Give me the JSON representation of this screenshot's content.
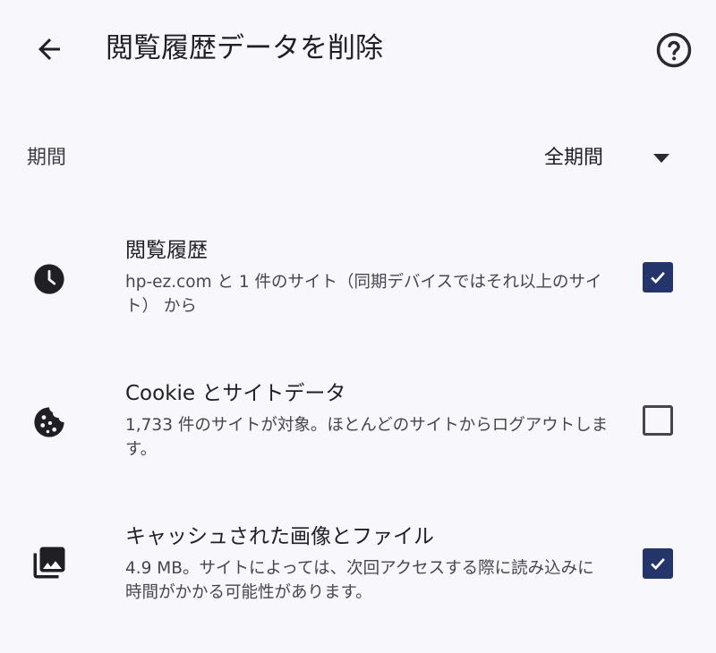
{
  "header": {
    "title": "閲覧履歴データを削除",
    "back_icon": "arrow-back-icon",
    "help_icon": "help-circle-icon"
  },
  "period": {
    "label": "期間",
    "value": "全期間"
  },
  "options": [
    {
      "icon": "clock-icon",
      "title": "閲覧履歴",
      "description": "hp-ez.com と 1 件のサイト（同期デバイスではそれ以上のサイト） から",
      "checked": true
    },
    {
      "icon": "cookie-icon",
      "title": "Cookie とサイトデータ",
      "description": "1,733 件のサイトが対象。ほとんどのサイトからログアウトします。",
      "checked": false
    },
    {
      "icon": "image-library-icon",
      "title": "キャッシュされた画像とファイル",
      "description": "4.9 MB。サイトによっては、次回アクセスする際に読み込みに時間がかかる可能性があります。",
      "checked": true
    }
  ],
  "colors": {
    "background": "#f8f7fc",
    "checkbox_checked": "#24356b",
    "text_primary": "#1f1f24",
    "text_secondary": "#46464d"
  }
}
